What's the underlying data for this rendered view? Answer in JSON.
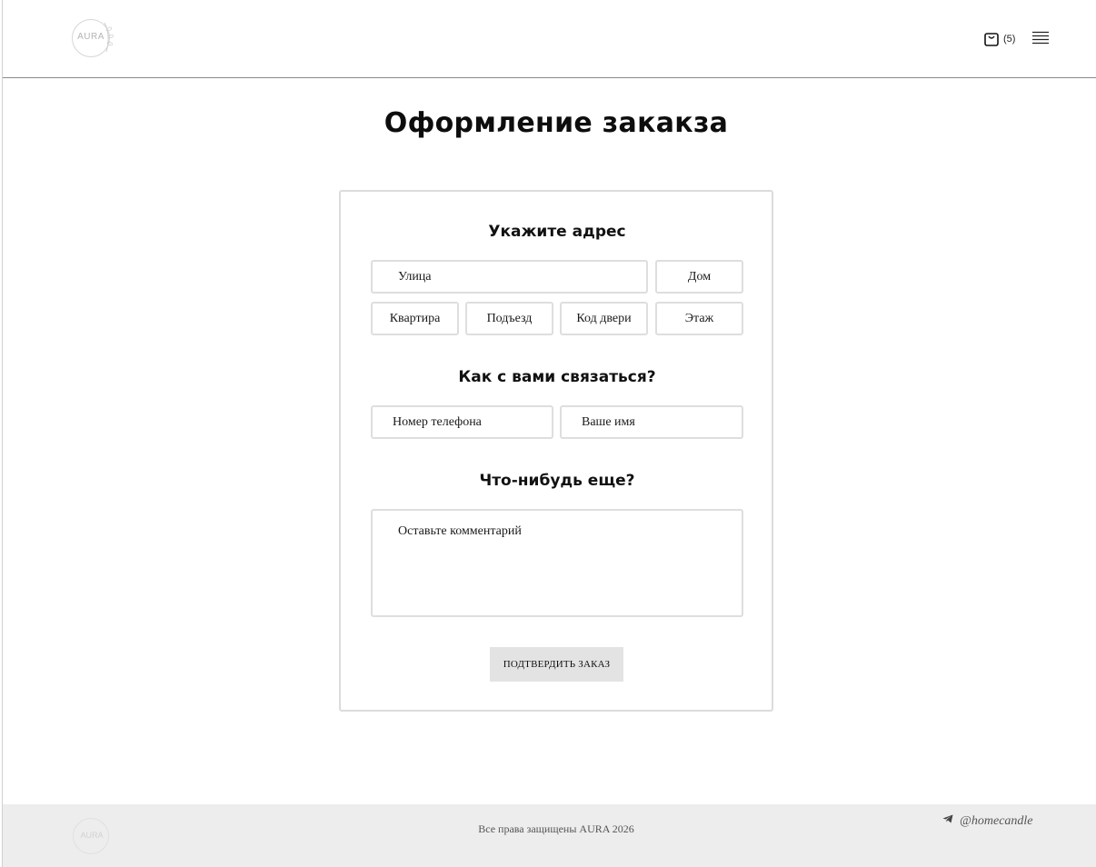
{
  "header": {
    "logo_text": "AURA",
    "cart_count": "(5)"
  },
  "page": {
    "title": "Оформление закакза"
  },
  "address": {
    "heading": "Укажите адрес",
    "street": "Улица",
    "house": "Дом",
    "apartment": "Квартира",
    "entrance": "Подъезд",
    "door_code": "Код двери",
    "floor": "Этаж"
  },
  "contact": {
    "heading": "Как с вами связаться?",
    "phone": "Номер телефона",
    "name": "Ваше имя"
  },
  "extra": {
    "heading": "Что-нибудь еще?",
    "comment": "Оставьте комментарий"
  },
  "actions": {
    "confirm_label": "ПОДТВЕРДИТЬ ЗАКАЗ"
  },
  "footer": {
    "logo_text": "AURA",
    "copyright": "Все права защищены AURA 2026",
    "telegram_handle": "@homecandle"
  },
  "icons": {
    "logo": "logo-icon",
    "cart": "shopping-bag-icon",
    "menu": "hamburger-menu-icon",
    "telegram": "telegram-icon"
  },
  "colors": {
    "footer_bg": "#ededed",
    "button_bg": "#e3e3e3",
    "border": "#dedede"
  }
}
